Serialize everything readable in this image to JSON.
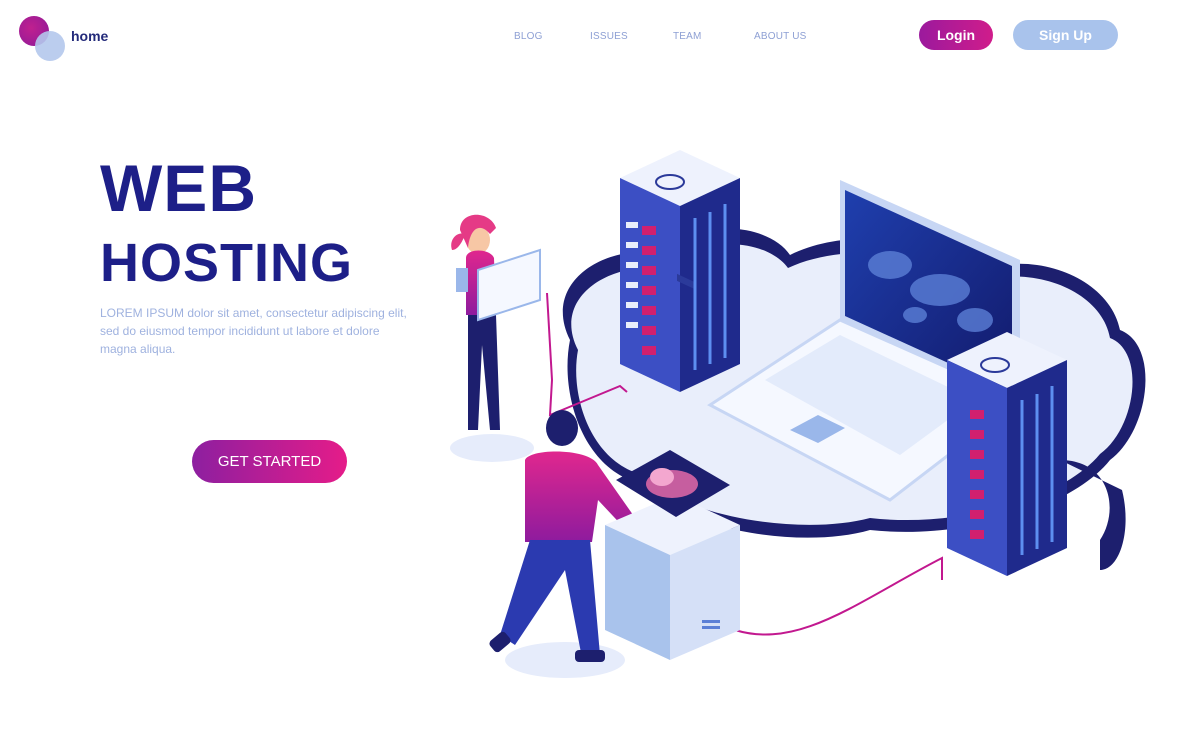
{
  "header": {
    "home_label": "home",
    "nav": [
      "BLOG",
      "ISSUES",
      "TEAM",
      "ABOUT US"
    ],
    "login_label": "Login",
    "signup_label": "Sign Up"
  },
  "hero": {
    "title_line1": "WEB",
    "title_line2": "HOSTING",
    "description": "LOREM IPSUM dolor sit amet, consectetur adipiscing elit, sed do eiusmod tempor incididunt ut labore et dolore magna aliqua.",
    "cta_label": "GET STARTED"
  },
  "colors": {
    "brand_navy": "#1d1f88",
    "accent_magenta": "#d01c8b",
    "accent_purple": "#9b1a9d",
    "soft_blue": "#a9c3ec",
    "text_muted": "#9fb2df"
  }
}
